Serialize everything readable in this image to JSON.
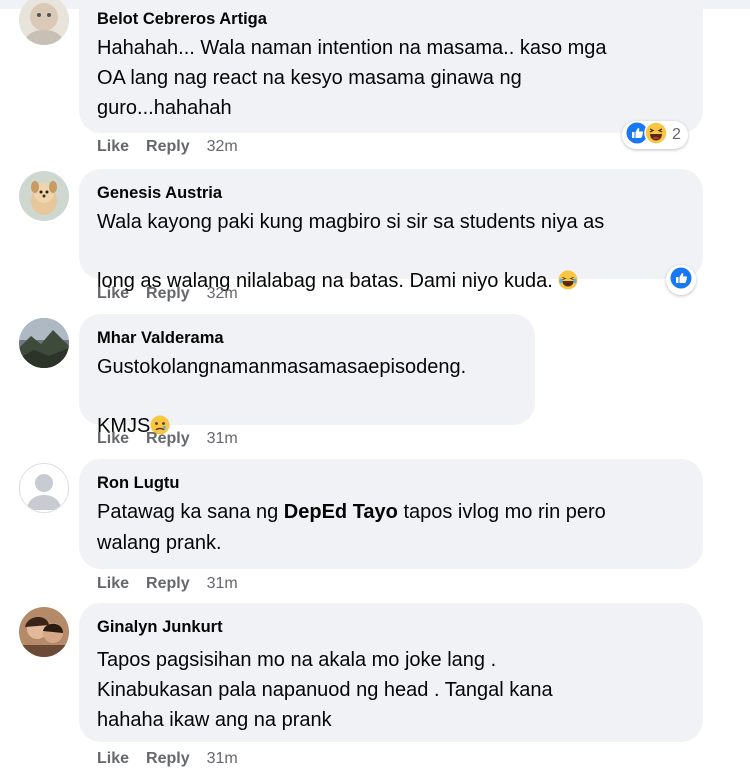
{
  "comments": [
    {
      "name": "Belot Cebreros Artiga",
      "lines": [
        "Hahahah... Wala naman intention na masama.. kaso mga",
        "OA lang nag react na kesyo masama ginawa ng",
        "guro...hahahah"
      ],
      "actions": {
        "like": "Like",
        "reply": "Reply",
        "time": "32m"
      },
      "reactions": {
        "icons": [
          "like-icon",
          "haha-icon"
        ],
        "count": "2"
      }
    },
    {
      "name": "Genesis Austria",
      "lines": [
        "Wala kayong paki kung magbiro si sir sa students niya as",
        "long as walang nilalabag na batas. Dami niyo kuda. "
      ],
      "emoji": "laughing-tears-icon",
      "actions": {
        "like": "Like",
        "reply": "Reply",
        "time": "32m"
      },
      "reactions": {
        "icons": [
          "like-icon"
        ],
        "count": ""
      }
    },
    {
      "name": "Mhar Valderama",
      "lines": [
        "Gustokolangnamanmasamasaepisodeng.",
        "KMJS"
      ],
      "emoji": "sad-face-icon",
      "actions": {
        "like": "Like",
        "reply": "Reply",
        "time": "31m"
      }
    },
    {
      "name": "Ron Lugtu",
      "line1_pre": "Patawag ka sana ng ",
      "line1_bold": "DepEd Tayo",
      "line1_post": " tapos ivlog mo rin pero",
      "line2": "walang prank.",
      "actions": {
        "like": "Like",
        "reply": "Reply",
        "time": "31m"
      }
    },
    {
      "name": "Ginalyn Junkurt",
      "lines": [
        "Tapos pagsisihan mo na akala mo joke lang .",
        "Kinabukasan pala napanuod ng head . Tangal kana",
        "hahaha ikaw ang na prank"
      ],
      "actions": {
        "like": "Like",
        "reply": "Reply",
        "time": "31m"
      }
    }
  ],
  "colors": {
    "bubble": "#f0f2f5",
    "like_blue": "#1877f2",
    "muted": "#65676b"
  }
}
